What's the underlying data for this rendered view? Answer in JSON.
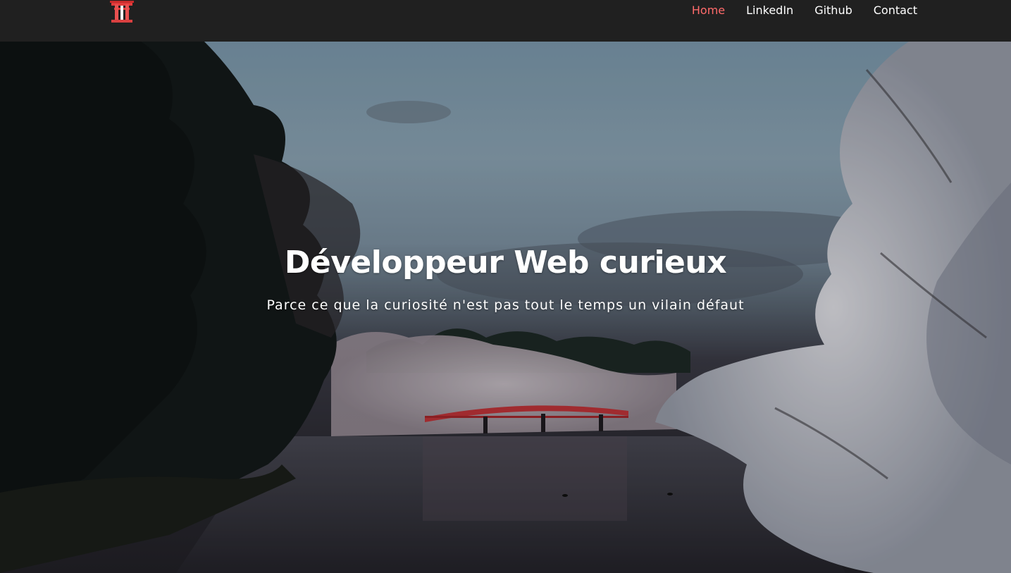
{
  "nav": {
    "logo_icon": "red-torii-gate-logo",
    "links": [
      {
        "label": "Home",
        "active": true
      },
      {
        "label": "LinkedIn",
        "active": false
      },
      {
        "label": "Github",
        "active": false
      },
      {
        "label": "Contact",
        "active": false
      }
    ],
    "active_color": "#ff6b6b",
    "background": "#202020"
  },
  "hero": {
    "title": "Développeur Web curieux",
    "subtitle": "Parce ce que la curiosité n'est pas tout le temps un vilain défaut"
  }
}
